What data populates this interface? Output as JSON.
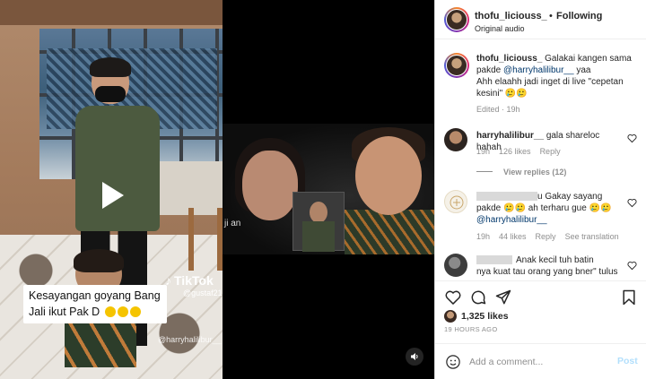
{
  "media": {
    "caption_line1": "Kesayangan goyang Bang",
    "caption_line2": "Jali ikut Pak D",
    "tiktok_brand": "TikTok",
    "tiktok_handle": "@gustaf21",
    "watermark": "@harryhalilibur__",
    "inset_label": "ji an"
  },
  "header": {
    "username": "thofu_liciouss_",
    "dot": "•",
    "follow_label": "Following",
    "audio": "Original audio"
  },
  "caption": {
    "username": "thofu_liciouss_",
    "text_before_mention": "Galakai kangen sama pakde",
    "mention": "@harryhalilibur__",
    "text_after_mention": "yaa",
    "line2": "Ahh elaahh jadi inget di live \"cepetan kesini\" 🥲🥲",
    "meta": "Edited · 19h"
  },
  "comments": [
    {
      "username": "harryhalilibur__",
      "text": "gala shareloc hahah",
      "time": "19h",
      "likes": "126 likes",
      "reply": "Reply",
      "view_replies": "View replies (12)"
    },
    {
      "username": "",
      "text_line1": "u Gakay sayang",
      "text_line2": "pakde 🥲🥲 ah terharu gue 🥲🥲",
      "mention": "@harryhalilibur__",
      "time": "19h",
      "likes": "44 likes",
      "reply": "Reply",
      "see_translation": "See translation"
    },
    {
      "username": "",
      "text_line1": "Anak kecil tuh batin",
      "text_line2": "nya kuat tau orang yang bner\" tulus"
    }
  ],
  "actions": {
    "likes": "1,325 likes",
    "time_ago": "19 HOURS AGO"
  },
  "composer": {
    "placeholder": "Add a comment...",
    "post_label": "Post"
  },
  "colors": {
    "link": "#00376b",
    "muted": "#8e8e8e",
    "post_disabled": "#b2dffc"
  }
}
